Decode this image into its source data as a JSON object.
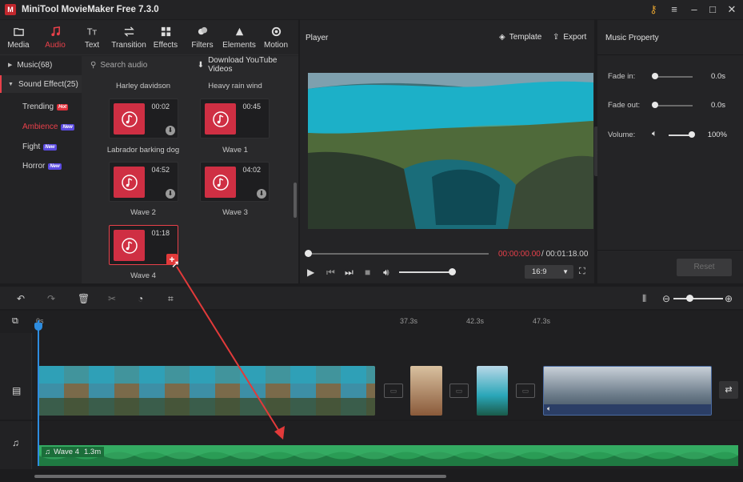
{
  "window": {
    "title": "MiniTool MovieMaker Free 7.3.0",
    "logo": "M"
  },
  "toolbar": {
    "items": [
      {
        "label": "Media",
        "icon": "media-icon"
      },
      {
        "label": "Audio",
        "icon": "music-note-icon",
        "active": true
      },
      {
        "label": "Text",
        "icon": "text-icon"
      },
      {
        "label": "Transition",
        "icon": "transition-icon"
      },
      {
        "label": "Effects",
        "icon": "effects-icon"
      },
      {
        "label": "Filters",
        "icon": "filters-icon"
      },
      {
        "label": "Elements",
        "icon": "elements-icon"
      },
      {
        "label": "Motion",
        "icon": "motion-icon"
      }
    ]
  },
  "categories": {
    "music": "Music(68)",
    "sound_effect": "Sound Effect(25)",
    "subs": [
      {
        "label": "Trending",
        "tag": "Hot"
      },
      {
        "label": "Ambience",
        "tag": "New",
        "active": true
      },
      {
        "label": "Fight",
        "tag": "New"
      },
      {
        "label": "Horror",
        "tag": "New"
      }
    ]
  },
  "library": {
    "search_placeholder": "Search audio",
    "download_label": "Download YouTube Videos",
    "items": [
      {
        "title": "Harley davidson"
      },
      {
        "title": "Heavy rain wind"
      },
      {
        "title": "Labrador barking dog",
        "duration": "00:02"
      },
      {
        "title": "Wave 1",
        "duration": "00:45"
      },
      {
        "title": "Wave 2",
        "duration": "04:52"
      },
      {
        "title": "Wave 3",
        "duration": "04:02"
      },
      {
        "title": "Wave 4",
        "duration": "01:18"
      }
    ]
  },
  "player": {
    "label": "Player",
    "template_label": "Template",
    "export_label": "Export",
    "time_current": "00:00:00.00",
    "time_sep": " / ",
    "time_total": "00:01:18.00",
    "ratio": "16:9",
    "progress": 0,
    "volume": 1.0
  },
  "properties": {
    "title": "Music Property",
    "fade_in_label": "Fade in:",
    "fade_in_value": "0.0s",
    "fade_out_label": "Fade out:",
    "fade_out_value": "0.0s",
    "volume_label": "Volume:",
    "volume_value": "100%",
    "reset_label": "Reset"
  },
  "timeline": {
    "ruler": [
      "0s",
      "37.3s",
      "42.3s",
      "47.3s"
    ],
    "audio_clip": {
      "name": "Wave 4",
      "length": "1.3m"
    }
  },
  "colors": {
    "accent": "#e8404a",
    "audio_clip": "#2a9c55",
    "playhead": "#2e8de0"
  }
}
